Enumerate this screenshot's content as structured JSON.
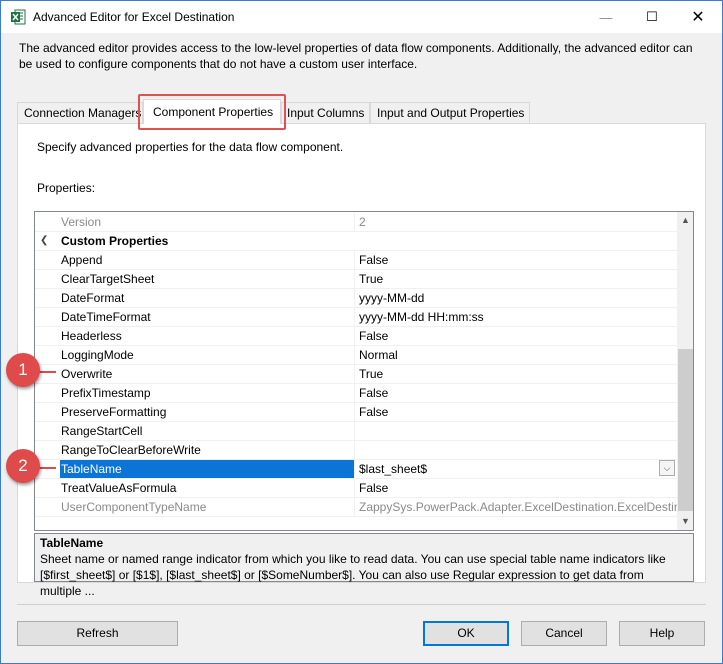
{
  "window": {
    "title": "Advanced Editor for Excel Destination",
    "minimize_glyph": "—",
    "maximize_glyph": "☐",
    "close_glyph": "✕"
  },
  "description": "The advanced editor provides access to the low-level properties of data flow components. Additionally, the advanced editor can be used to configure components that do not have a custom user interface.",
  "tabs": [
    {
      "label": "Connection Managers"
    },
    {
      "label": "Component Properties"
    },
    {
      "label": "Input Columns"
    },
    {
      "label": "Input and Output Properties"
    }
  ],
  "panel": {
    "description": "Specify advanced properties for the data flow component.",
    "properties_label": "Properties:"
  },
  "grid": {
    "rows": [
      {
        "name": "Version",
        "value": "2"
      },
      {
        "name": "Custom Properties",
        "value": ""
      },
      {
        "name": "Append",
        "value": "False"
      },
      {
        "name": "ClearTargetSheet",
        "value": "True"
      },
      {
        "name": "DateFormat",
        "value": "yyyy-MM-dd"
      },
      {
        "name": "DateTimeFormat",
        "value": "yyyy-MM-dd HH:mm:ss"
      },
      {
        "name": "Headerless",
        "value": "False"
      },
      {
        "name": "LoggingMode",
        "value": "Normal"
      },
      {
        "name": "Overwrite",
        "value": "True"
      },
      {
        "name": "PrefixTimestamp",
        "value": "False"
      },
      {
        "name": "PreserveFormatting",
        "value": "False"
      },
      {
        "name": "RangeStartCell",
        "value": ""
      },
      {
        "name": "RangeToClearBeforeWrite",
        "value": ""
      },
      {
        "name": "TableName",
        "value": "$last_sheet$"
      },
      {
        "name": "TreatValueAsFormula",
        "value": "False"
      },
      {
        "name": "UserComponentTypeName",
        "value": "ZappySys.PowerPack.Adapter.ExcelDestination.ExcelDestinat"
      }
    ]
  },
  "help": {
    "title": "TableName",
    "text": "Sheet name or named range indicator from which you like to read data. You can use special table name indicators like [$first_sheet$] or [$1$], [$last_sheet$] or [$SomeNumber$]. You can also use Regular expression to get data from multiple ..."
  },
  "markers": [
    "1",
    "2"
  ],
  "buttons": {
    "refresh": "Refresh",
    "ok": "OK",
    "cancel": "Cancel",
    "help": "Help"
  },
  "colors": {
    "accent": "#0a74d7",
    "marker": "#df4a4a",
    "excel_green": "#1e7145"
  }
}
